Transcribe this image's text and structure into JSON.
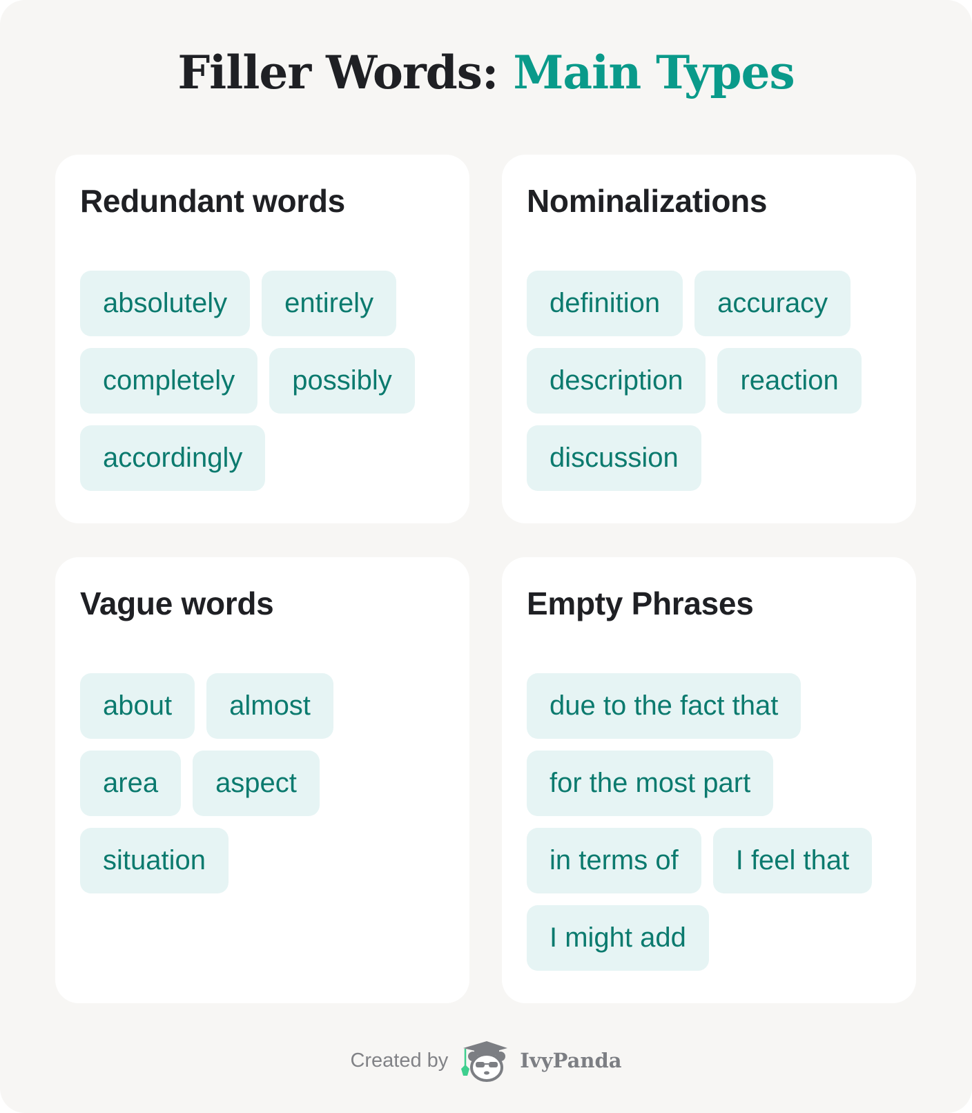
{
  "title": {
    "main": "Filler Words: ",
    "accent": "Main Types"
  },
  "colors": {
    "background": "#f7f6f4",
    "card": "#ffffff",
    "accent": "#0a9a8a",
    "chip_bg": "#e6f4f4",
    "chip_text": "#0b7a6e",
    "heading": "#1f2024"
  },
  "cards": [
    {
      "heading": "Redundant words",
      "chips": [
        "absolutely",
        "entirely",
        "completely",
        "possibly",
        "accordingly"
      ]
    },
    {
      "heading": "Nominalizations",
      "chips": [
        "definition",
        "accuracy",
        "description",
        "reaction",
        "discussion"
      ]
    },
    {
      "heading": "Vague words",
      "chips": [
        "about",
        "almost",
        "area",
        "aspect",
        "situation"
      ]
    },
    {
      "heading": "Empty Phrases",
      "chips": [
        "due to the fact that",
        "for the most part",
        "in terms of",
        "I feel that",
        "I might add"
      ]
    }
  ],
  "footer": {
    "created_by": "Created by",
    "brand": "IvyPanda",
    "logo_icon": "panda-graduate-icon"
  }
}
